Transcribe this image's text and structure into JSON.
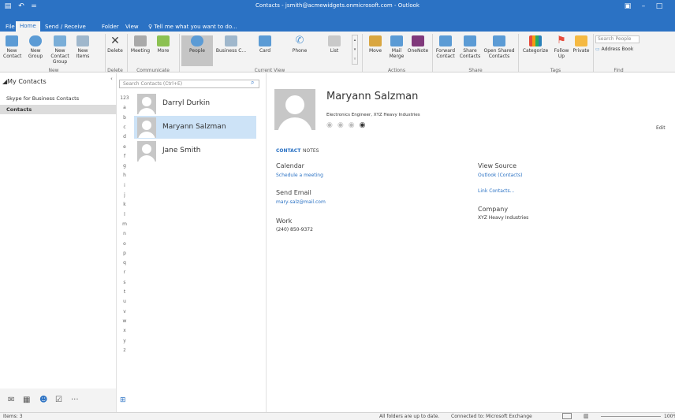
{
  "title": "Contacts - jsmith@acmewidgets.onmicrosoft.com - Outlook",
  "tabs": [
    "File",
    "Home",
    "Send / Receive",
    "Folder",
    "View"
  ],
  "tell_me": "Tell me what you want to do...",
  "ribbon": {
    "new": {
      "new_contact": "New Contact",
      "new_group": "New Group",
      "new_contact2": "New Contact Group",
      "new_items": "New Items",
      "label": "New"
    },
    "delete": {
      "delete": "Delete",
      "label": "Delete"
    },
    "communicate": {
      "meeting": "Meeting",
      "more": "More",
      "label": "Communicate"
    },
    "current_view": {
      "people": "People",
      "business": "Business C...",
      "card": "Card",
      "phone": "Phone",
      "list": "List",
      "label": "Current View"
    },
    "actions": {
      "move": "Move",
      "mail_merge": "Mail Merge",
      "onenote": "OneNote",
      "label": "Actions"
    },
    "share": {
      "forward": "Forward Contact",
      "share": "Share Contacts",
      "open_shared": "Open Shared Contacts",
      "label": "Share"
    },
    "tags": {
      "categorize": "Categorize",
      "follow_up": "Follow Up",
      "private": "Private",
      "label": "Tags"
    },
    "find": {
      "search_people": "Search People",
      "address_book": "Address Book",
      "label": "Find"
    }
  },
  "nav": {
    "header": "My Contacts",
    "items": [
      "Skype for Business Contacts",
      "Contacts"
    ]
  },
  "search": {
    "placeholder": "Search Contacts (Ctrl+E)"
  },
  "alphabet": [
    "123",
    "a",
    "b",
    "c",
    "d",
    "e",
    "f",
    "g",
    "h",
    "i",
    "j",
    "k",
    "l",
    "m",
    "n",
    "o",
    "p",
    "q",
    "r",
    "s",
    "t",
    "u",
    "v",
    "w",
    "x",
    "y",
    "z"
  ],
  "contacts": [
    "Darryl Durkin",
    "Maryann Salzman",
    "Jane Smith"
  ],
  "detail": {
    "name": "Maryann Salzman",
    "subtitle": "Electronics Engineer, XYZ Heavy Industries",
    "edit": "Edit",
    "tab_contact": "CONTACT",
    "tab_notes": "NOTES",
    "calendar_label": "Calendar",
    "calendar_link": "Schedule a meeting",
    "email_label": "Send Email",
    "email": "mary-salz@mail.com",
    "work_label": "Work",
    "work": "(240) 850-9372",
    "source_label": "View Source",
    "source": "Outlook (Contacts)",
    "link_contacts": "Link Contacts...",
    "company_label": "Company",
    "company": "XYZ Heavy Industries"
  },
  "status": {
    "items": "Items: 3",
    "sync": "All folders are up to date.",
    "conn": "Connected to: Microsoft Exchange",
    "zoom": "100%"
  },
  "colors": {
    "accent": "#2b72c4",
    "selected": "#cde3f7"
  }
}
